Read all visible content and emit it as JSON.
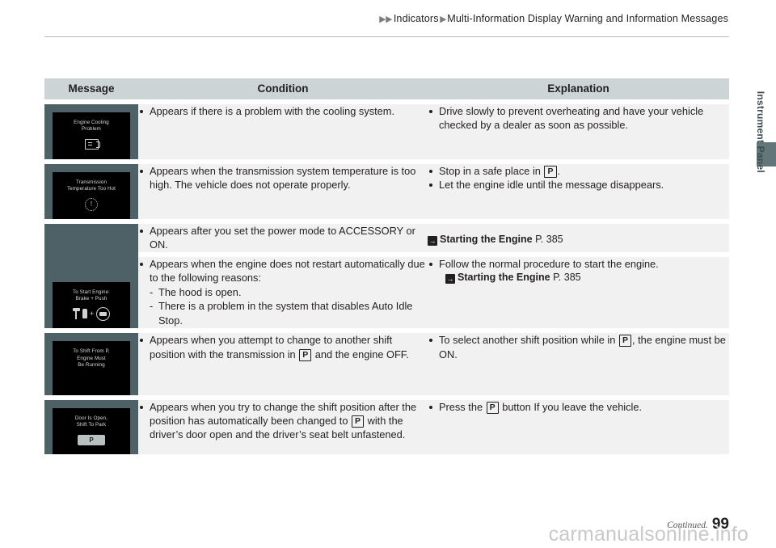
{
  "header": {
    "breadcrumb": {
      "arrow": "▶",
      "level1": "Indicators",
      "level2": "Multi-Information Display Warning and Information Messages"
    }
  },
  "side_tab": {
    "label": "Instrument Panel"
  },
  "table": {
    "columns": [
      "Message",
      "Condition",
      "Explanation"
    ],
    "rows": [
      {
        "display": {
          "lines": [
            "Engine Cooling",
            "Problem"
          ],
          "icon": "radiator-icon"
        },
        "condition": {
          "bullets": [
            "Appears if there is a problem with the cooling system."
          ]
        },
        "explanation": {
          "bullets": [
            "Drive slowly to prevent overheating and have your vehicle checked by a dealer as soon as possible."
          ]
        }
      },
      {
        "display": {
          "lines": [
            "Transmission",
            "Temperature Too Hot"
          ],
          "icon": "gear-warning-icon"
        },
        "condition": {
          "bullets": [
            "Appears when the transmission system temperature is too high. The vehicle does not operate properly."
          ]
        },
        "explanation": {
          "bullet1_pre": "Stop in a safe place in ",
          "bullet1_key": "P",
          "bullet1_post": ".",
          "bullet2": "Let the engine idle until the message disappears."
        }
      },
      {
        "display": {
          "lines": [
            "To Start Engine:",
            "Brake + Push"
          ],
          "icon": "brake-push-icon"
        },
        "sub_a": {
          "condition_bullet": "Appears after you set the power mode to ACCESSORY or ON.",
          "reference": {
            "icon": "→",
            "title": "Starting the Engine",
            "page": "P. 385"
          }
        },
        "sub_b": {
          "condition_bullet": "Appears when the engine does not restart automatically due to the following reasons:",
          "condition_sublines": [
            "The hood is open.",
            "There is a problem in the system that disables Auto Idle Stop."
          ],
          "explanation_bullet": "Follow the normal procedure to start the engine.",
          "reference": {
            "icon": "→",
            "title": "Starting the Engine",
            "page": "P. 385"
          }
        }
      },
      {
        "display": {
          "lines": [
            "To Shift From P,",
            "Engine Must",
            "Be Running"
          ],
          "icon": "none"
        },
        "condition": {
          "pre": "Appears when you attempt to change to another shift position with the transmission in ",
          "key": "P",
          "post": " and the engine OFF."
        },
        "explanation": {
          "pre": "To select another shift position while in ",
          "key": "P",
          "post": ", the engine must be ON."
        }
      },
      {
        "display": {
          "lines": [
            "Door Is Open,",
            "Shift To Park"
          ],
          "icon": "p-button-icon",
          "icon_label": "P"
        },
        "condition": {
          "pre": "Appears when you try to change the shift position after the position has automatically been changed to ",
          "key": "P",
          "post": " with the driver’s door open and the driver’s seat belt unfastened."
        },
        "explanation": {
          "pre": "Press the ",
          "key": "P",
          "post": " button If you leave the vehicle."
        }
      }
    ]
  },
  "footer": {
    "continued": "Continued.",
    "page_number": "99",
    "watermark": "carmanualsonline.info"
  },
  "colors": {
    "header_band": "#ccd4d5",
    "message_cell": "#4e6166",
    "body_cell": "#f1f1f1",
    "display_bg": "#000000",
    "side_tab": "#63767a"
  }
}
